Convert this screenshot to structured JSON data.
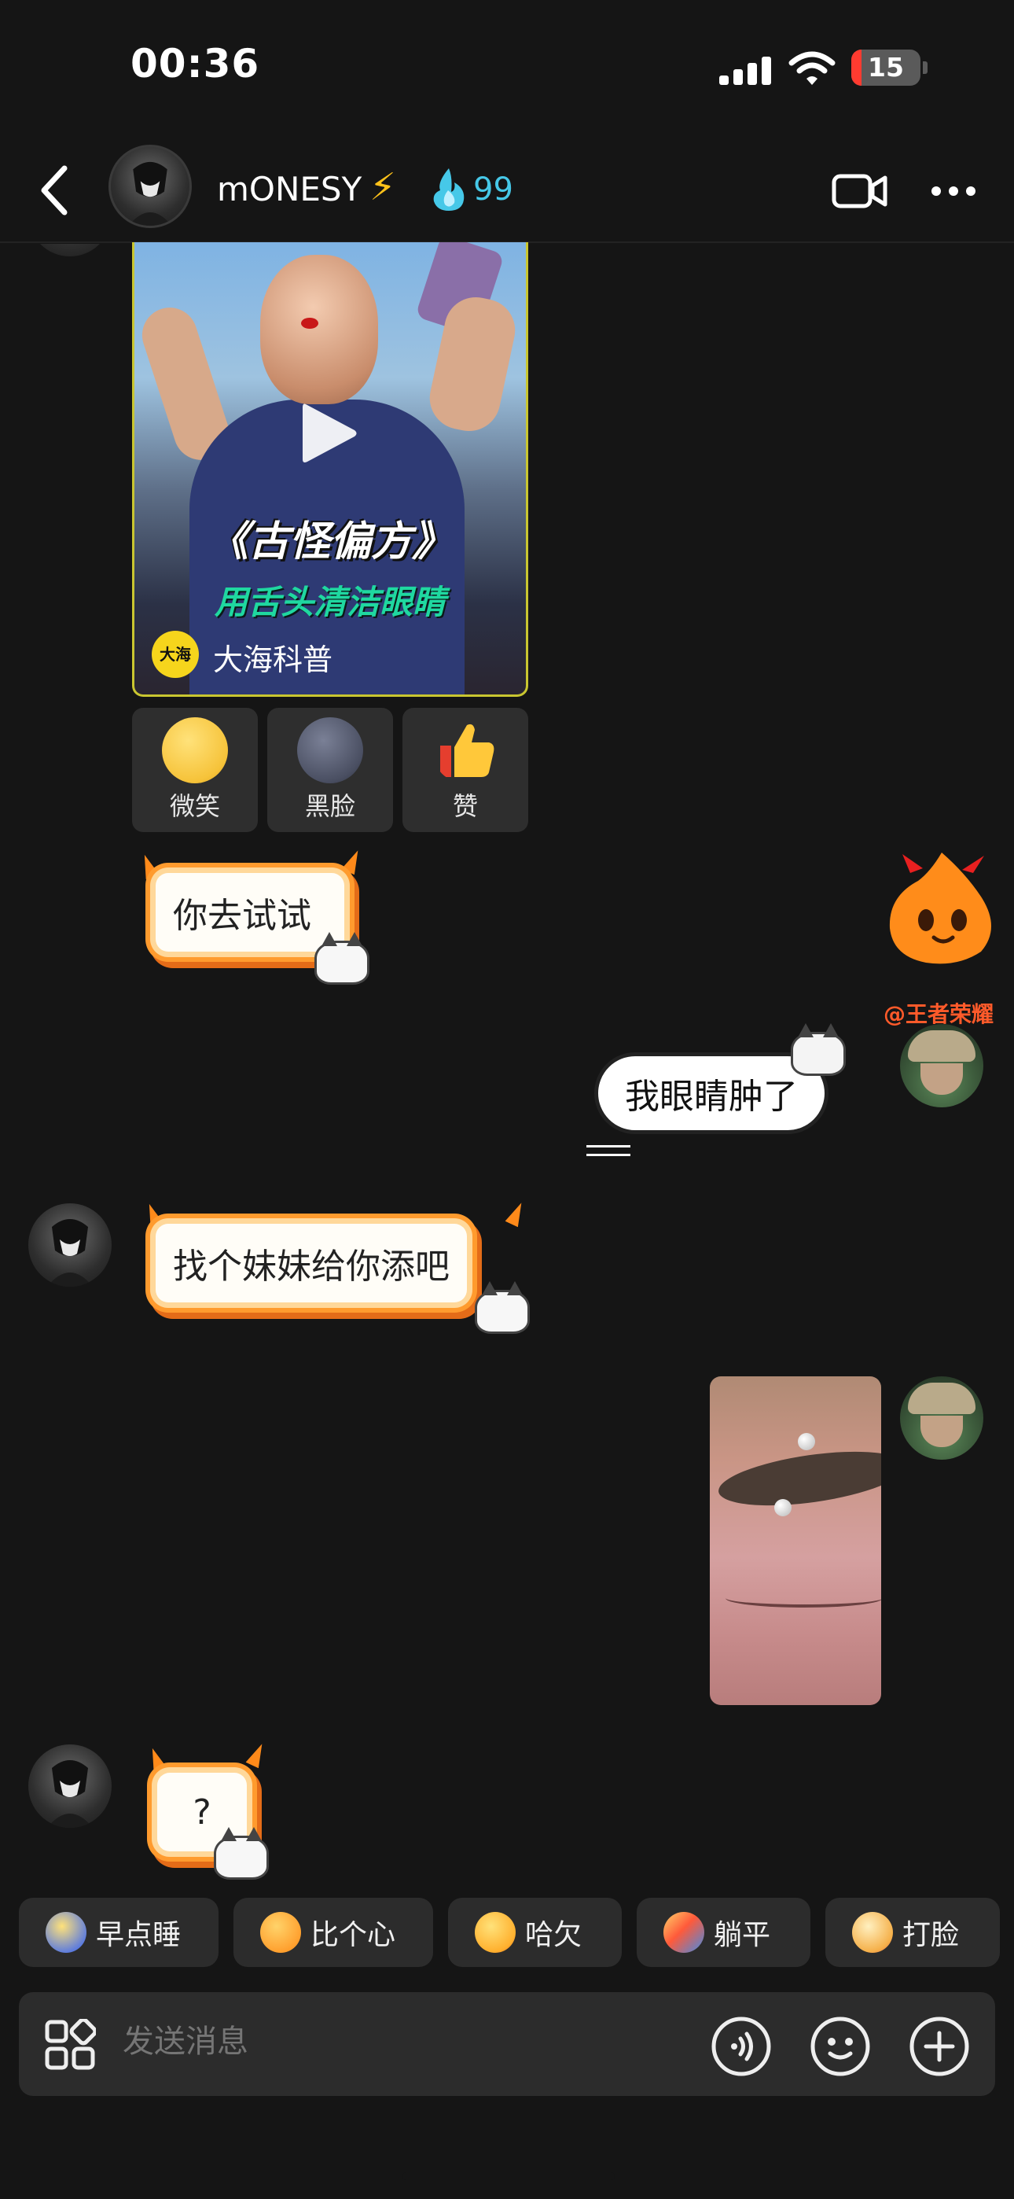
{
  "status_bar": {
    "time": "00:36",
    "battery": "15",
    "battery_level": 0.15,
    "battery_color": "#ff3b30"
  },
  "header": {
    "contact_name": "mONESY",
    "bolt_emoji": "⚡",
    "fire_count": "99",
    "fire_color": "#46c8e8"
  },
  "shared_video": {
    "title": "《古怪偏方》",
    "subtitle": "用舌头清洁眼睛",
    "author": "大海科普",
    "author_logo": "大海",
    "play_icon": "play-icon",
    "accent": "#c9c630"
  },
  "reactions": [
    {
      "label": "微笑",
      "color": "#f6c33a"
    },
    {
      "label": "黑脸",
      "color": "#4a4f62"
    },
    {
      "label": "赞",
      "color": "#ffc83a"
    }
  ],
  "messages": {
    "m1": "你去试试",
    "m2": "我眼睛肿了",
    "m3": "找个妹妹给你添吧",
    "m4": "?"
  },
  "mascot_tag": "@王者荣耀",
  "quick_replies": [
    {
      "label": "早点睡",
      "color": "#5a7adf"
    },
    {
      "label": "比个心",
      "color": "#ff9d2b"
    },
    {
      "label": "哈欠",
      "color": "#ffb02e"
    },
    {
      "label": "躺平",
      "color": "#3f8ce8"
    },
    {
      "label": "打脸",
      "color": "#f5b04a"
    }
  ],
  "input": {
    "placeholder": "发送消息"
  }
}
